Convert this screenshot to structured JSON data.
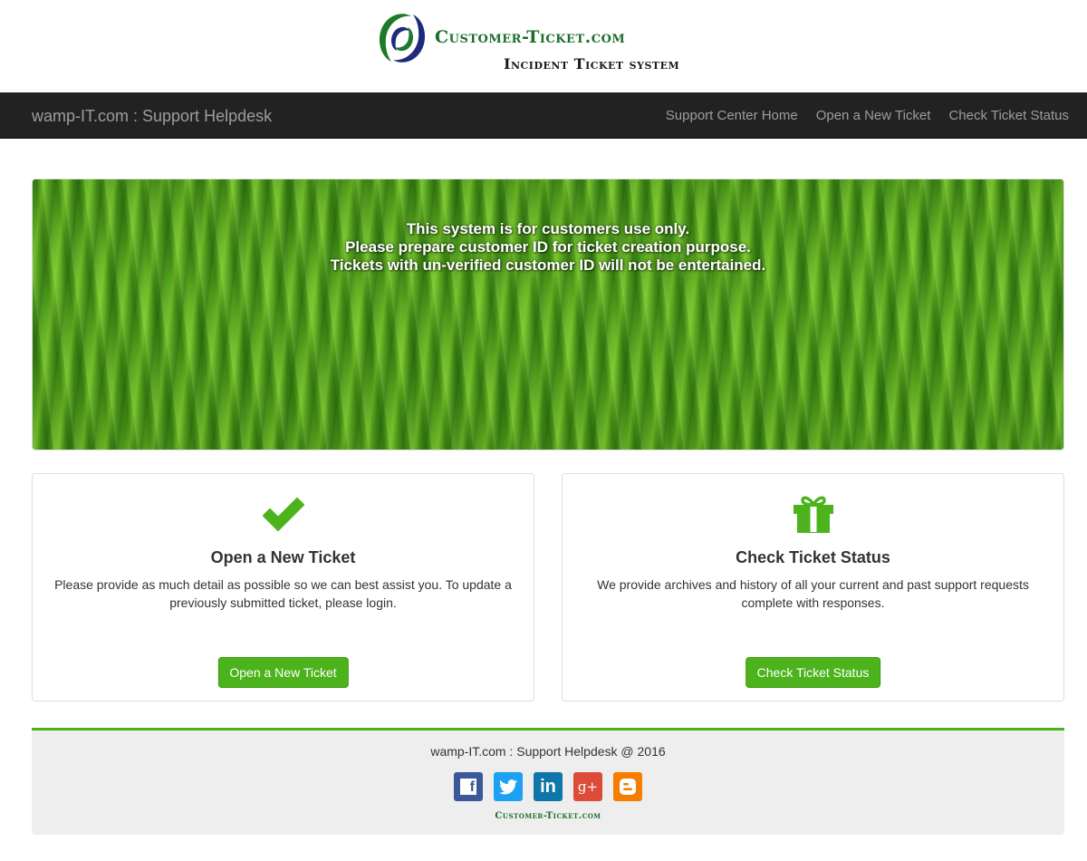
{
  "logo": {
    "brand": "Customer-Ticket.com",
    "tagline": "Incident Ticket system"
  },
  "navbar": {
    "brand": "wamp-IT.com : Support Helpdesk",
    "links": [
      {
        "label": "Support Center Home"
      },
      {
        "label": "Open a New Ticket"
      },
      {
        "label": "Check Ticket Status"
      }
    ]
  },
  "banner": {
    "lines": [
      "This system is for customers use only.",
      "Please prepare customer ID for ticket creation purpose.",
      "Tickets with un-verified customer ID will not be entertained."
    ]
  },
  "cards": [
    {
      "icon": "checkmark-icon",
      "title": "Open a New Ticket",
      "description": "Please provide as much detail as possible so we can best assist you. To update a previously submitted ticket, please login.",
      "button": "Open a New Ticket"
    },
    {
      "icon": "gift-icon",
      "title": "Check Ticket Status",
      "description": "We provide archives and history of all your current and past support requests complete with responses.",
      "button": "Check Ticket Status"
    }
  ],
  "footer": {
    "copyright": "wamp-IT.com : Support Helpdesk @ 2016",
    "social": [
      {
        "name": "facebook",
        "glyph": "f",
        "color": "#3b5998"
      },
      {
        "name": "twitter",
        "glyph": "t",
        "color": "#1da1f2"
      },
      {
        "name": "linkedin",
        "glyph": "in",
        "color": "#0e76a8"
      },
      {
        "name": "google-plus",
        "glyph": "g+",
        "color": "#dd4b39"
      },
      {
        "name": "blogger",
        "glyph": "B",
        "color": "#f57d00"
      }
    ],
    "brand": "Customer-Ticket.com"
  },
  "colors": {
    "accent": "#4cb31c",
    "navbar": "#222222",
    "nav_text": "#9d9d9d"
  }
}
